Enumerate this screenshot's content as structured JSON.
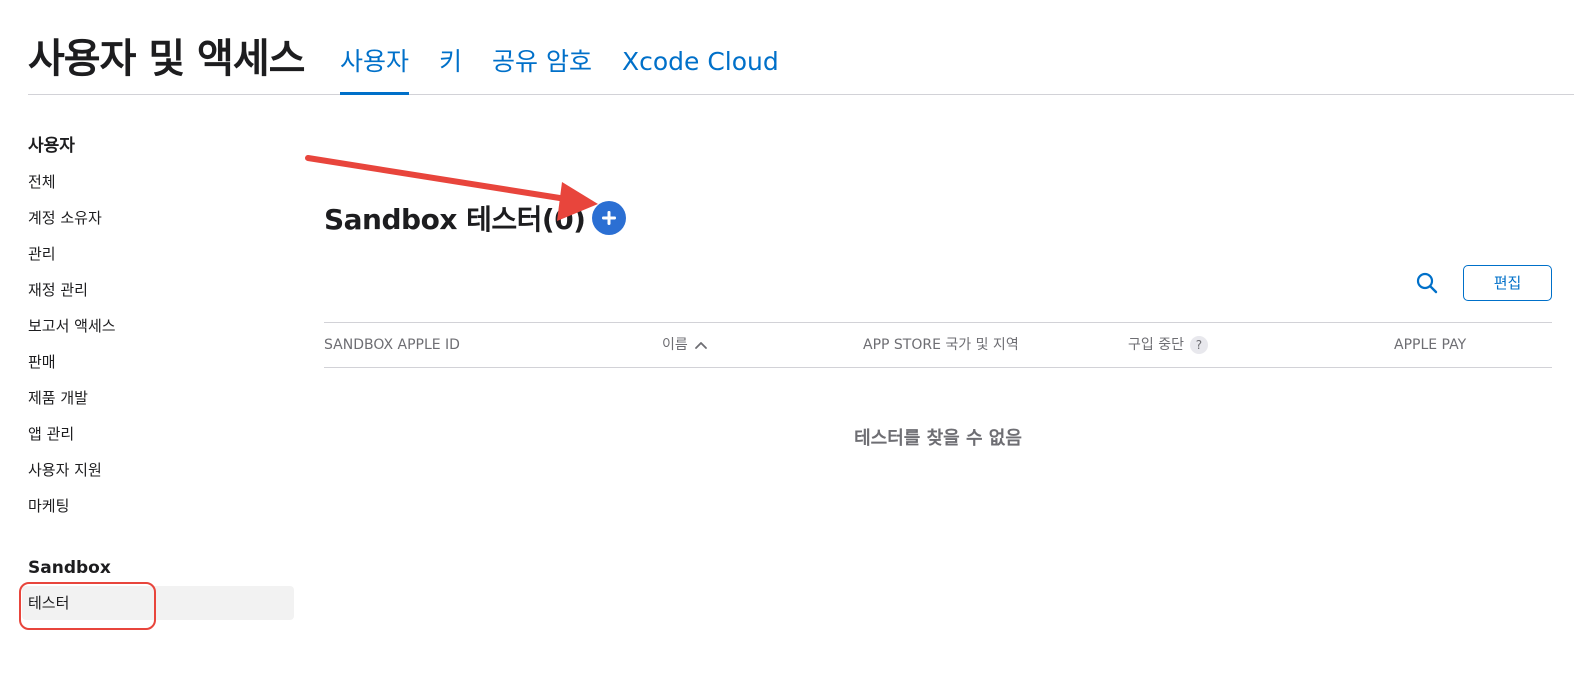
{
  "header": {
    "title": "사용자 및 액세스",
    "tabs": [
      {
        "label": "사용자",
        "active": true
      },
      {
        "label": "키",
        "active": false
      },
      {
        "label": "공유 암호",
        "active": false
      },
      {
        "label": "Xcode Cloud",
        "active": false
      }
    ]
  },
  "sidebar": {
    "users_heading": "사용자",
    "users_items": [
      "전체",
      "계정 소유자",
      "관리",
      "재정 관리",
      "보고서 액세스",
      "판매",
      "제품 개발",
      "앱 관리",
      "사용자 지원",
      "마케팅"
    ],
    "sandbox_heading": "Sandbox",
    "sandbox_items": [
      "테스터"
    ]
  },
  "main": {
    "section_title": "Sandbox 테스터(0)",
    "add_icon": "plus-circle-icon",
    "search_icon": "search-icon",
    "edit_label": "편집",
    "table": {
      "columns": [
        "SANDBOX APPLE ID",
        "이름",
        "APP STORE 국가 및 지역",
        "구입 중단",
        "APPLE PAY"
      ],
      "help_glyph": "?",
      "sort_indicator": "^"
    },
    "empty_message": "테스터를 찾을 수 없음"
  },
  "colors": {
    "accent": "#0070c9",
    "add_button": "#2b6fd3",
    "annotation": "#e8453c"
  }
}
